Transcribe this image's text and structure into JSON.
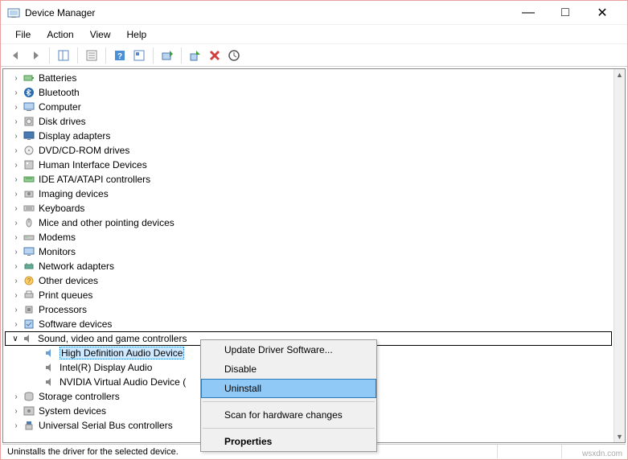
{
  "title": "Device Manager",
  "menubar": [
    "File",
    "Action",
    "View",
    "Help"
  ],
  "tree": {
    "devices": [
      {
        "label": "Batteries",
        "icon": "battery"
      },
      {
        "label": "Bluetooth",
        "icon": "bluetooth"
      },
      {
        "label": "Computer",
        "icon": "computer"
      },
      {
        "label": "Disk drives",
        "icon": "disk"
      },
      {
        "label": "Display adapters",
        "icon": "display"
      },
      {
        "label": "DVD/CD-ROM drives",
        "icon": "disc"
      },
      {
        "label": "Human Interface Devices",
        "icon": "hid"
      },
      {
        "label": "IDE ATA/ATAPI controllers",
        "icon": "ide"
      },
      {
        "label": "Imaging devices",
        "icon": "camera"
      },
      {
        "label": "Keyboards",
        "icon": "keyboard"
      },
      {
        "label": "Mice and other pointing devices",
        "icon": "mouse"
      },
      {
        "label": "Modems",
        "icon": "modem"
      },
      {
        "label": "Monitors",
        "icon": "monitor"
      },
      {
        "label": "Network adapters",
        "icon": "network"
      },
      {
        "label": "Other devices",
        "icon": "other"
      },
      {
        "label": "Print queues",
        "icon": "printer"
      },
      {
        "label": "Processors",
        "icon": "cpu"
      },
      {
        "label": "Software devices",
        "icon": "software"
      }
    ],
    "expanded_category": "Sound, video and game controllers",
    "children": [
      "High Definition Audio Device",
      "Intel(R) Display Audio",
      "NVIDIA Virtual Audio Device ("
    ],
    "post": [
      {
        "label": "Storage controllers",
        "icon": "storage"
      },
      {
        "label": "System devices",
        "icon": "system"
      },
      {
        "label": "Universal Serial Bus controllers",
        "icon": "usb"
      }
    ]
  },
  "context_menu": {
    "items1": [
      "Update Driver Software...",
      "Disable",
      "Uninstall"
    ],
    "items2": [
      "Scan for hardware changes"
    ],
    "items3": [
      "Properties"
    ],
    "highlighted": "Uninstall"
  },
  "status": "Uninstalls the driver for the selected device.",
  "watermark": "wsxdn.com"
}
